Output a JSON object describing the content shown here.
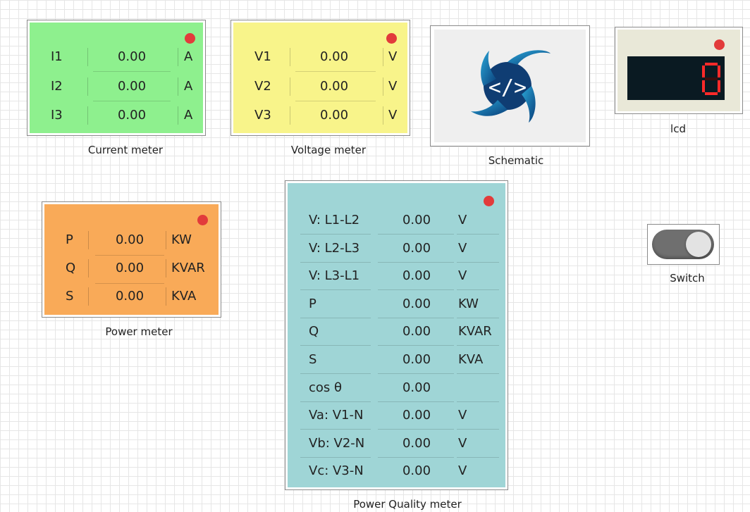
{
  "current_meter": {
    "caption": "Current meter",
    "face_color": "#8ef08e",
    "rows": [
      {
        "label": "I1",
        "value": "0.00",
        "unit": "A"
      },
      {
        "label": "I2",
        "value": "0.00",
        "unit": "A"
      },
      {
        "label": "I3",
        "value": "0.00",
        "unit": "A"
      }
    ]
  },
  "voltage_meter": {
    "caption": "Voltage meter",
    "face_color": "#f8f48a",
    "rows": [
      {
        "label": "V1",
        "value": "0.00",
        "unit": "V"
      },
      {
        "label": "V2",
        "value": "0.00",
        "unit": "V"
      },
      {
        "label": "V3",
        "value": "0.00",
        "unit": "V"
      }
    ]
  },
  "schematic": {
    "caption": "Schematic"
  },
  "lcd": {
    "caption": "lcd",
    "digit": "0"
  },
  "power_meter": {
    "caption": "Power meter",
    "face_color": "#f9aa58",
    "rows": [
      {
        "label": "P",
        "value": "0.00",
        "unit": "KW"
      },
      {
        "label": "Q",
        "value": "0.00",
        "unit": "KVAR"
      },
      {
        "label": "S",
        "value": "0.00",
        "unit": "KVA"
      }
    ]
  },
  "power_quality_meter": {
    "caption": "Power Quality meter",
    "face_color": "#9fd5d6",
    "rows": [
      {
        "label": "V: L1-L2",
        "value": "0.00",
        "unit": "V"
      },
      {
        "label": "V: L2-L3",
        "value": "0.00",
        "unit": "V"
      },
      {
        "label": "V: L3-L1",
        "value": "0.00",
        "unit": "V"
      },
      {
        "label": "P",
        "value": "0.00",
        "unit": "KW"
      },
      {
        "label": "Q",
        "value": "0.00",
        "unit": "KVAR"
      },
      {
        "label": "S",
        "value": "0.00",
        "unit": "KVA"
      },
      {
        "label": "cos θ",
        "value": "0.00",
        "unit": ""
      },
      {
        "label": "Va: V1-N",
        "value": "0.00",
        "unit": "V"
      },
      {
        "label": "Vb: V2-N",
        "value": "0.00",
        "unit": "V"
      },
      {
        "label": "Vc: V3-N",
        "value": "0.00",
        "unit": "V"
      }
    ]
  },
  "switch": {
    "caption": "Switch",
    "state": "off"
  },
  "status_led_color": "#e23b3b"
}
